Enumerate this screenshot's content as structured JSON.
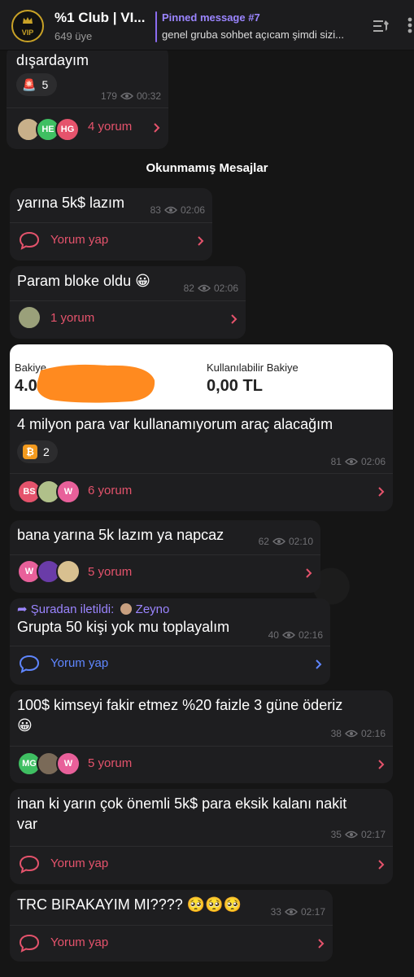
{
  "header": {
    "title": "%1 Club | VI...",
    "members": "649 üye",
    "logo_text": "VIP",
    "pinned_title": "Pinned message #7",
    "pinned_text": "genel gruba sohbet açıcam şimdi sizi..."
  },
  "unread_label": "Okunmamış Mesajlar",
  "messages": [
    {
      "text": "dışardayım",
      "reaction": {
        "emoji": "🚨",
        "count": "5"
      },
      "views": "179",
      "time": "00:32",
      "comments": "4 yorum",
      "avatars": [
        {
          "initials": "",
          "color": "#c8b08a"
        },
        {
          "initials": "HE",
          "color": "#3fbf62"
        },
        {
          "initials": "HG",
          "color": "#e5536c"
        }
      ]
    },
    {
      "text": "yarına 5k$ lazım",
      "views": "83",
      "time": "02:06",
      "comments": "Yorum yap"
    },
    {
      "text": "Param bloke oldu 😀",
      "views": "82",
      "time": "02:06",
      "comments": "1 yorum",
      "avatars": [
        {
          "initials": "",
          "color": "#9aa07a"
        }
      ]
    },
    {
      "balance": {
        "label1": "Bakiye",
        "value1": "4.0",
        "label2": "Kullanılabilir Bakiye",
        "value2": "0,00 TL"
      },
      "text": "4 milyon para var kullanamıyorum araç alacağım",
      "reaction": {
        "emoji": "₿",
        "count": "2"
      },
      "views": "81",
      "time": "02:06",
      "comments": "6 yorum",
      "avatars": [
        {
          "initials": "BS",
          "color": "#e5536c"
        },
        {
          "initials": "",
          "color": "#b0c08a"
        },
        {
          "initials": "W",
          "color": "#e8609a"
        }
      ]
    },
    {
      "text": "bana yarına 5k lazım ya napcaz",
      "views": "62",
      "time": "02:10",
      "comments": "5 yorum",
      "avatars": [
        {
          "initials": "W",
          "color": "#e8609a"
        },
        {
          "initials": "",
          "color": "#6a3ca8"
        },
        {
          "initials": "",
          "color": "#d8c090"
        }
      ]
    },
    {
      "forwarded": "Şuradan iletildi:",
      "forwarded_name": "Zeyno",
      "text": "Grupta 50 kişi yok mu toplayalım",
      "views": "40",
      "time": "02:16",
      "comments": "Yorum yap"
    },
    {
      "text": "100$ kimseyi fakir etmez %20 faizle 3 güne öderiz",
      "text2": "😀",
      "views": "38",
      "time": "02:16",
      "comments": "5 yorum",
      "avatars": [
        {
          "initials": "MG",
          "color": "#3fbf62"
        },
        {
          "initials": "",
          "color": "#7a6a58"
        },
        {
          "initials": "W",
          "color": "#e8609a"
        }
      ]
    },
    {
      "text": "inan ki yarın çok önemli 5k$ para eksik kalanı nakit",
      "text2": "var",
      "views": "35",
      "time": "02:17",
      "comments": "Yorum yap"
    },
    {
      "text": "TRC BIRAKAYIM MI???? 🥺🥺🥺",
      "views": "33",
      "time": "02:17",
      "comments": "Yorum yap"
    }
  ],
  "colors": {
    "accent_red": "#e5536c",
    "accent_blue": "#5f86ff",
    "accent_purple": "#9b85ff",
    "bubble": "#1e1e20"
  }
}
